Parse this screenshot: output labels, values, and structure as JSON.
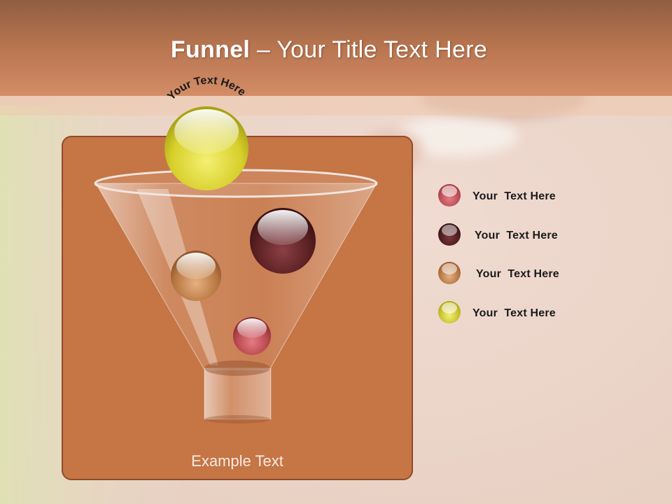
{
  "title": {
    "strong": "Funnel",
    "rest": " – Your Title Text Here"
  },
  "top_ball_caption": "Your Text Here",
  "panel_caption": "Example Text",
  "legend": [
    {
      "label": "Your  Text Here",
      "color": "#b8474f",
      "icon": "red-ball-icon"
    },
    {
      "label": "Your  Text Here",
      "color": "#5a1f22",
      "icon": "dark-maroon-ball-icon"
    },
    {
      "label": "Your  Text Here",
      "color": "#b26b3c",
      "icon": "tan-ball-icon"
    },
    {
      "label": "Your  Text Here",
      "color": "#c8c21a",
      "icon": "yellow-ball-icon"
    }
  ],
  "colors": {
    "header": "#b5734e",
    "panel": "#c67545",
    "ball_red": "#b8474f",
    "ball_maroon": "#5a1f22",
    "ball_tan": "#b26b3c",
    "ball_yellow": "#c8c21a"
  }
}
